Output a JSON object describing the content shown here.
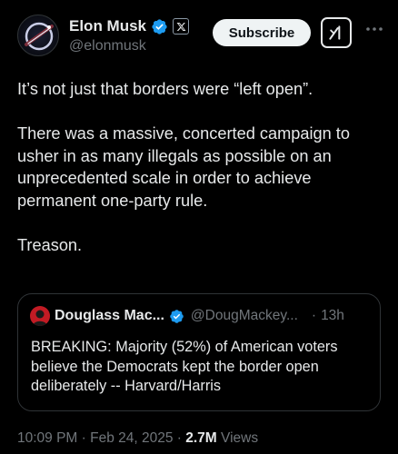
{
  "author": {
    "name": "Elon Musk",
    "handle": "@elonmusk",
    "verified_color": "#1d9bf0"
  },
  "actions": {
    "subscribe_label": "Subscribe",
    "grok_icon": "grok-icon",
    "more_icon": "more-icon"
  },
  "tweet": {
    "line1": "It’s not just that borders were “left open”.",
    "paragraph2": "There was a massive, concerted campaign to usher in as many illegals as possible on an unprecedented scale in order to achieve permanent one-party rule.",
    "line3": "Treason."
  },
  "quote": {
    "name": "Douglass Mac...",
    "handle": "@DougMackey...",
    "separator": "·",
    "time": "13h",
    "text": "BREAKING: Majority (52%) of American voters believe the Democrats kept the border open deliberately -- Harvard/Harris"
  },
  "meta": {
    "time_date": "10:09 PM · Feb 24, 2025 · ",
    "views_count": "2.7M",
    "views_label": " Views"
  }
}
